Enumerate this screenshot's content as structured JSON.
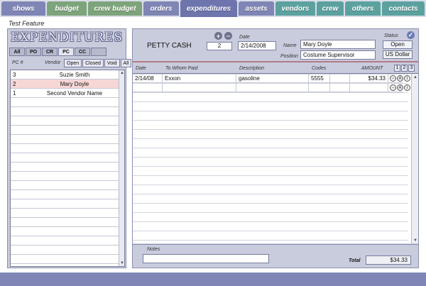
{
  "nav": {
    "shows": "shows",
    "budget": "budget",
    "crew_budget": "crew budget",
    "orders": "orders",
    "expenditures": "expenditures",
    "assets": "assets",
    "vendors": "vendors",
    "crew": "crew",
    "others": "others",
    "contacts": "contacts"
  },
  "subtitle": "Test Feature",
  "left": {
    "logo": "EXPENDITURES",
    "types": [
      "All",
      "PO",
      "CR",
      "PC",
      "CC"
    ],
    "col_pc": "PC #",
    "col_vendor": "Vendor",
    "status_filters": [
      "Open",
      "Closed",
      "Void",
      "All"
    ],
    "rows": [
      {
        "pc": "3",
        "vendor": "Suzie Smith"
      },
      {
        "pc": "2",
        "vendor": "Mary Doyle"
      },
      {
        "pc": "1",
        "vendor": "Second Vendor Name"
      }
    ]
  },
  "header": {
    "petty": "PETTY CASH",
    "number": "2",
    "date_label": "Date",
    "date": "2/14/2008",
    "name_label": "Name",
    "name": "Mary Doyle",
    "position_label": "Position",
    "position": "Costume Supervisor",
    "status_label": "Status",
    "status": "Open",
    "currency": "US Dollar"
  },
  "grid": {
    "h_date": "Date",
    "h_paid": "To Whom Paid",
    "h_desc": "Description",
    "h_codes": "Codes",
    "h_amount": "AMOUNT",
    "pages": [
      "1",
      "2",
      "3"
    ],
    "rows": [
      {
        "date": "2/14/08",
        "paid": "Exxon",
        "desc": "gasoline",
        "code": "5555",
        "amount": "$34.33"
      }
    ]
  },
  "footer": {
    "notes_label": "Notes",
    "total_label": "Total",
    "total": "$34.33"
  }
}
